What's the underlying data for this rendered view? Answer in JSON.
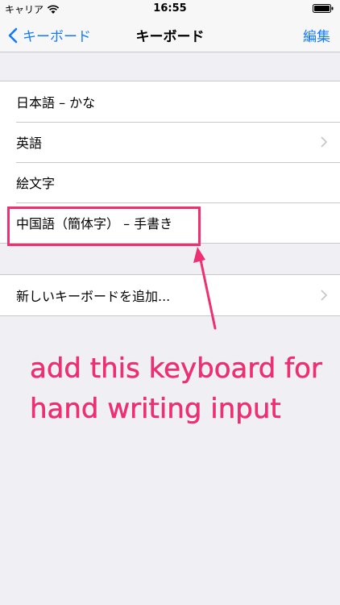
{
  "status_bar": {
    "carrier": "キャリア",
    "time": "16:55"
  },
  "nav": {
    "back_label": "キーボード",
    "title": "キーボード",
    "edit_label": "編集"
  },
  "keyboards": [
    {
      "label": "日本語 – かな"
    },
    {
      "label": "英語"
    },
    {
      "label": "絵文字"
    },
    {
      "label": "中国語（簡体字） – 手書き"
    }
  ],
  "add_keyboard": {
    "label": "新しいキーボードを追加..."
  },
  "annotation": {
    "text": "add this keyboard for hand writing input"
  },
  "colors": {
    "accent": "#127afb",
    "annotation": "#ee2f72",
    "background": "#efeff4"
  },
  "icons": [
    "wifi-icon",
    "battery-icon",
    "chevron-left-icon",
    "chevron-right-icon",
    "arrow-icon"
  ]
}
